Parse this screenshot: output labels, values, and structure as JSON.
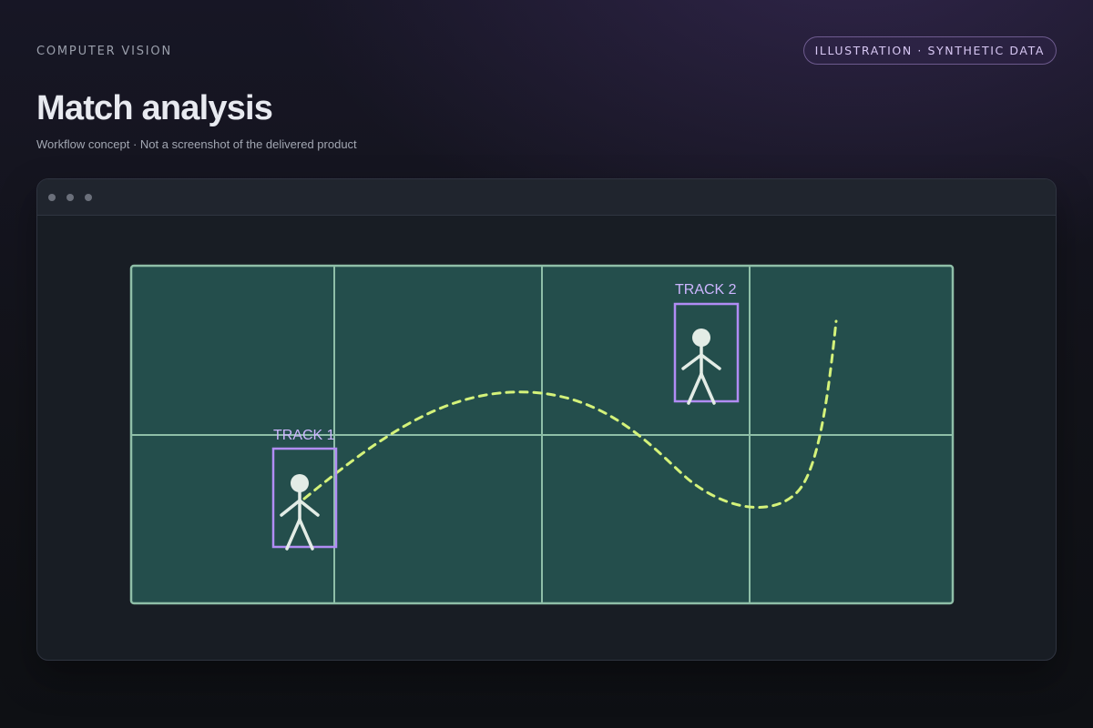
{
  "header": {
    "eyebrow": "COMPUTER VISION",
    "badge": "ILLUSTRATION · SYNTHETIC DATA",
    "title": "Match analysis",
    "subtitle": "Workflow concept · Not a screenshot of the delivered product"
  },
  "window": {
    "controls": [
      "window-dot",
      "window-dot",
      "window-dot"
    ]
  },
  "pitch": {
    "tracks": [
      {
        "label": "TRACK 1"
      },
      {
        "label": "TRACK 2"
      }
    ]
  },
  "colors": {
    "pitch_fill": "#244e4c",
    "pitch_lines": "#8fbfa8",
    "track_box": "#b18cf5",
    "track_label": "#cdb6ff",
    "trajectory": "#d4f27a",
    "player": "#e3ece6"
  }
}
